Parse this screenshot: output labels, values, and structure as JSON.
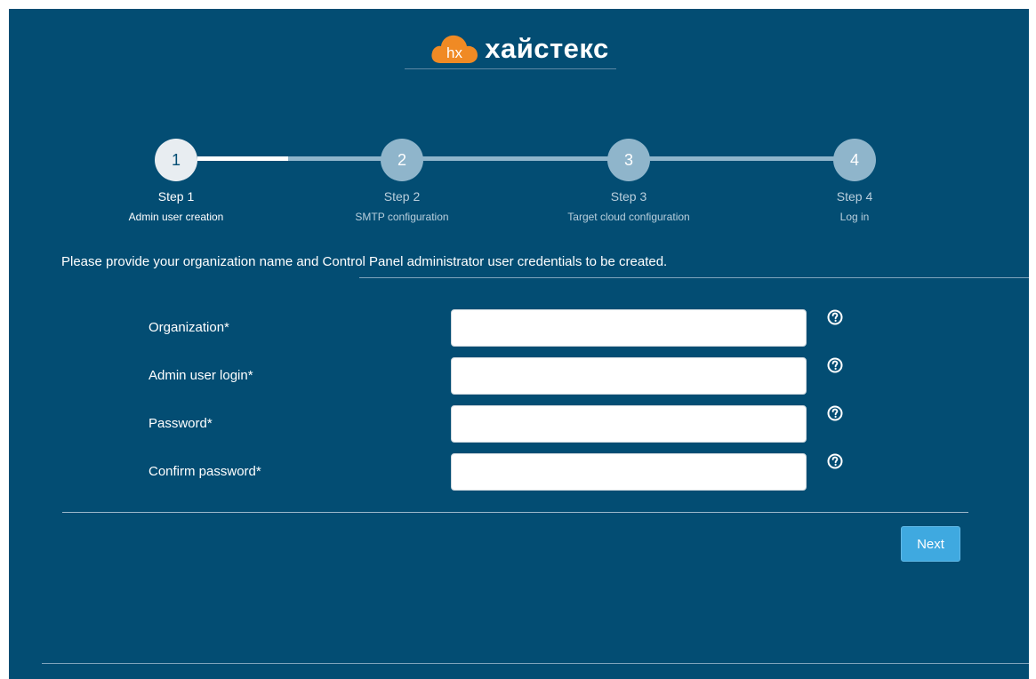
{
  "brand": {
    "logo_mark_text": "hx",
    "name": "хайстекс",
    "accent_color": "#f08a24",
    "background_color": "#034d73"
  },
  "stepper": {
    "current_step": 1,
    "steps": [
      {
        "number": "1",
        "title": "Step 1",
        "subtitle": "Admin user creation"
      },
      {
        "number": "2",
        "title": "Step 2",
        "subtitle": "SMTP configuration"
      },
      {
        "number": "3",
        "title": "Step 3",
        "subtitle": "Target cloud configuration"
      },
      {
        "number": "4",
        "title": "Step 4",
        "subtitle": "Log in"
      }
    ]
  },
  "intro_text": "Please provide your organization name and  Control Panel administrator user credentials to be created.",
  "form": {
    "fields": [
      {
        "label": "Organization*",
        "value": "",
        "help_icon": "question-circle-icon"
      },
      {
        "label": "Admin user login*",
        "value": "",
        "help_icon": "question-circle-icon"
      },
      {
        "label": "Password*",
        "value": "",
        "help_icon": "question-circle-icon"
      },
      {
        "label": "Confirm password*",
        "value": "",
        "help_icon": "question-circle-icon"
      }
    ]
  },
  "actions": {
    "next_label": "Next"
  }
}
